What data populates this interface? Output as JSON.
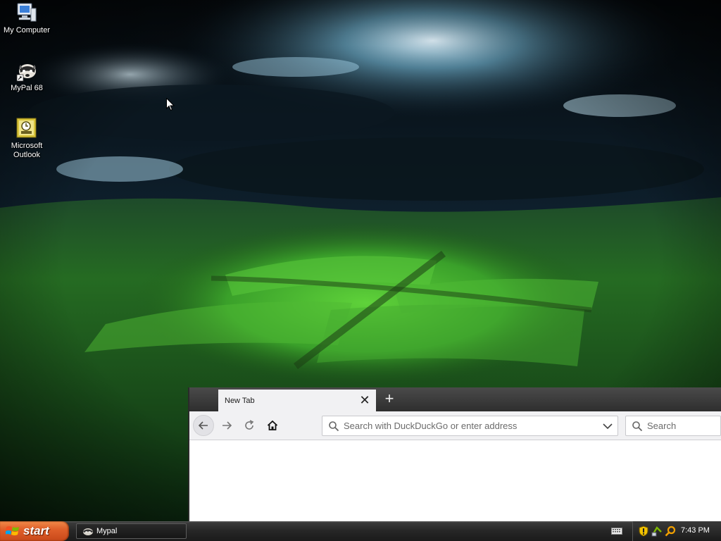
{
  "desktop": {
    "icons": [
      {
        "label": "My Computer",
        "icon": "my-computer-icon"
      },
      {
        "label": "MyPal 68",
        "icon": "mypal-icon"
      },
      {
        "label": "Microsoft\nOutlook",
        "icon": "outlook-icon"
      }
    ]
  },
  "browser": {
    "tab": {
      "title": "New Tab",
      "close_glyph": "✕"
    },
    "new_tab_glyph": "+",
    "url_placeholder": "Search with DuckDuckGo or enter address",
    "search_placeholder": "Search"
  },
  "taskbar": {
    "start_label": "start",
    "tasks": [
      {
        "label": "Mypal",
        "icon": "mypal-icon"
      }
    ],
    "tray_icons": [
      "keyboard-icon",
      "shield-icon",
      "network-icon",
      "search-icon"
    ],
    "clock": "7:43 PM"
  },
  "colors": {
    "start_button": "#e0602a",
    "taskbar": "#262626",
    "grass": "#3aa02a",
    "sky": "#0c1a24"
  }
}
